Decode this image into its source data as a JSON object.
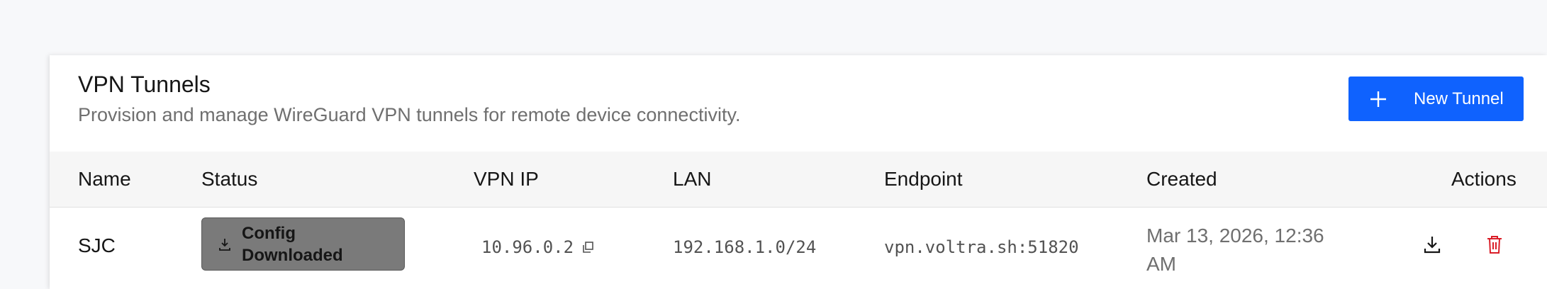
{
  "header": {
    "title": "VPN Tunnels",
    "subtitle": "Provision and manage WireGuard VPN tunnels for remote device connectivity.",
    "new_button_label": "New Tunnel"
  },
  "table": {
    "columns": {
      "name": "Name",
      "status": "Status",
      "vpn_ip": "VPN IP",
      "lan": "LAN",
      "endpoint": "Endpoint",
      "created": "Created",
      "actions": "Actions"
    },
    "rows": [
      {
        "name": "SJC",
        "status": "Config Downloaded",
        "vpn_ip": "10.96.0.2",
        "lan": "192.168.1.0/24",
        "endpoint": "vpn.voltra.sh:51820",
        "created": "Mar 13, 2026, 12:36 AM"
      }
    ]
  },
  "icons": {
    "new_button": "plus-icon",
    "status": "download-icon",
    "vpn_ip_copy": "copy-icon",
    "row_download": "download-icon",
    "row_delete": "trash-icon"
  },
  "colors": {
    "primary": "#0f62fe",
    "danger": "#da1e28",
    "status_badge_bg": "#7a7a7a",
    "header_row_bg": "#f6f6f6",
    "page_bg": "#f7f8fa"
  }
}
